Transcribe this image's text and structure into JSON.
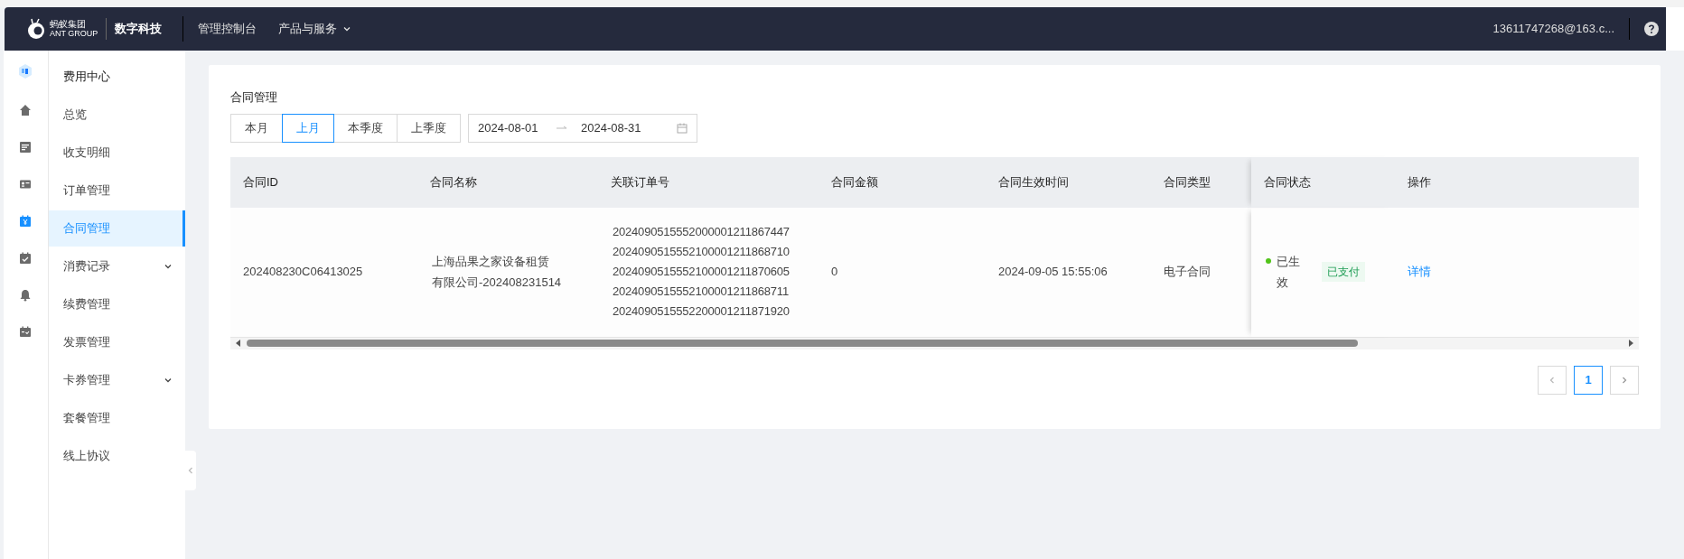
{
  "topbar": {
    "brand_cn": "蚂蚁集团",
    "brand_en": "ANT GROUP",
    "product": "数字科技",
    "nav": [
      {
        "label": "管理控制台",
        "dropdown": false
      },
      {
        "label": "产品与服务",
        "dropdown": true
      }
    ],
    "account": "13611747268@163.c..."
  },
  "rail": [
    {
      "kind": "logo",
      "selected": false
    },
    {
      "kind": "home",
      "selected": false
    },
    {
      "kind": "doc",
      "selected": false
    },
    {
      "kind": "card",
      "selected": false
    },
    {
      "kind": "yen",
      "selected": true
    },
    {
      "kind": "check",
      "selected": false
    },
    {
      "kind": "bell",
      "selected": false
    },
    {
      "kind": "cal",
      "selected": false
    }
  ],
  "sidebar": {
    "title": "费用中心",
    "items": [
      {
        "label": "总览",
        "selected": false,
        "expandable": false
      },
      {
        "label": "收支明细",
        "selected": false,
        "expandable": false
      },
      {
        "label": "订单管理",
        "selected": false,
        "expandable": false
      },
      {
        "label": "合同管理",
        "selected": true,
        "expandable": false
      },
      {
        "label": "消费记录",
        "selected": false,
        "expandable": true
      },
      {
        "label": "续费管理",
        "selected": false,
        "expandable": false
      },
      {
        "label": "发票管理",
        "selected": false,
        "expandable": false
      },
      {
        "label": "卡券管理",
        "selected": false,
        "expandable": true
      },
      {
        "label": "套餐管理",
        "selected": false,
        "expandable": false
      },
      {
        "label": "线上协议",
        "selected": false,
        "expandable": false
      }
    ]
  },
  "page": {
    "title": "合同管理",
    "periods": [
      {
        "label": "本月",
        "selected": false
      },
      {
        "label": "上月",
        "selected": true
      },
      {
        "label": "本季度",
        "selected": false
      },
      {
        "label": "上季度",
        "selected": false
      }
    ],
    "date_range": {
      "start": "2024-08-01",
      "end": "2024-08-31"
    },
    "table": {
      "columns": [
        "合同ID",
        "合同名称",
        "关联订单号",
        "合同金额",
        "合同生效时间",
        "合同类型",
        "合同状态",
        "操作"
      ],
      "rows": [
        {
          "id": "202408230C06413025",
          "name": [
            "上海品果之家设备租赁",
            "有限公司-202408231514"
          ],
          "orders": [
            "2024090515552000001211867447",
            "2024090515552100001211868710",
            "2024090515552100001211870605",
            "2024090515552100001211868711",
            "2024090515552200001211871920"
          ],
          "amount": "0",
          "effective": "2024-09-05 15:55:06",
          "type": "电子合同",
          "status": {
            "text": "已生效",
            "color": "#52c41a"
          },
          "tag": "已支付",
          "action": "详情"
        }
      ]
    },
    "pagination": {
      "pages": [
        {
          "label": "1",
          "selected": true
        }
      ]
    }
  }
}
